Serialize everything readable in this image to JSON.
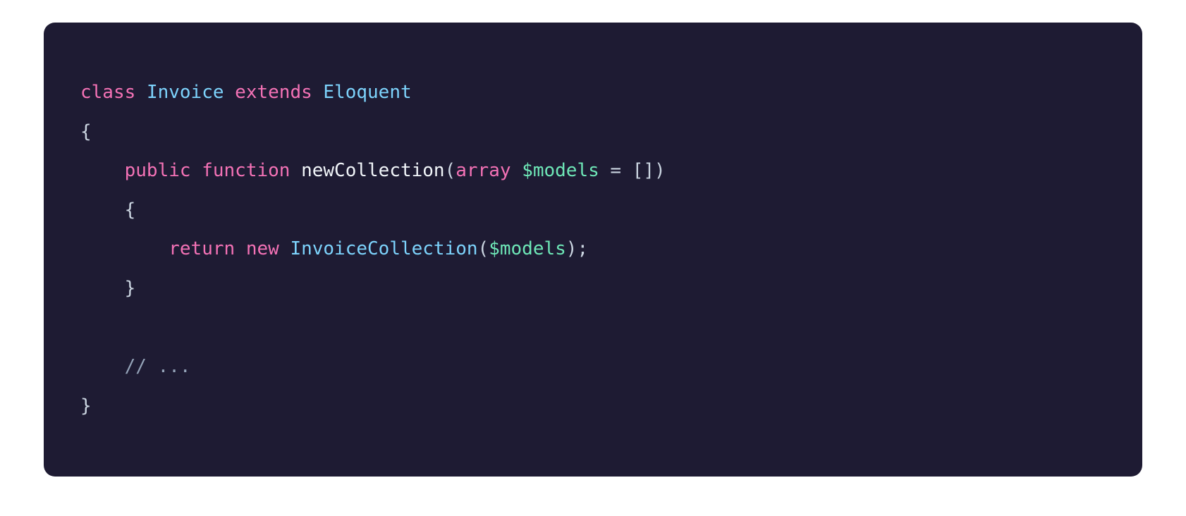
{
  "code": {
    "tokens": [
      [
        {
          "t": "class",
          "c": "tok-keyword"
        },
        {
          "t": " ",
          "c": ""
        },
        {
          "t": "Invoice",
          "c": "tok-class"
        },
        {
          "t": " ",
          "c": ""
        },
        {
          "t": "extends",
          "c": "tok-keyword"
        },
        {
          "t": " ",
          "c": ""
        },
        {
          "t": "Eloquent",
          "c": "tok-class"
        }
      ],
      [
        {
          "t": "{",
          "c": "tok-punct"
        }
      ],
      [
        {
          "t": "    ",
          "c": ""
        },
        {
          "t": "public",
          "c": "tok-keyword"
        },
        {
          "t": " ",
          "c": ""
        },
        {
          "t": "function",
          "c": "tok-keyword"
        },
        {
          "t": " ",
          "c": ""
        },
        {
          "t": "newCollection",
          "c": "tok-func"
        },
        {
          "t": "(",
          "c": "tok-punct"
        },
        {
          "t": "array",
          "c": "tok-type"
        },
        {
          "t": " ",
          "c": ""
        },
        {
          "t": "$models",
          "c": "tok-var"
        },
        {
          "t": " ",
          "c": ""
        },
        {
          "t": "=",
          "c": "tok-punct"
        },
        {
          "t": " ",
          "c": ""
        },
        {
          "t": "[]",
          "c": "tok-punct"
        },
        {
          "t": ")",
          "c": "tok-punct"
        }
      ],
      [
        {
          "t": "    ",
          "c": ""
        },
        {
          "t": "{",
          "c": "tok-punct"
        }
      ],
      [
        {
          "t": "        ",
          "c": ""
        },
        {
          "t": "return",
          "c": "tok-keyword"
        },
        {
          "t": " ",
          "c": ""
        },
        {
          "t": "new",
          "c": "tok-keyword"
        },
        {
          "t": " ",
          "c": ""
        },
        {
          "t": "InvoiceCollection",
          "c": "tok-class"
        },
        {
          "t": "(",
          "c": "tok-punct"
        },
        {
          "t": "$models",
          "c": "tok-var"
        },
        {
          "t": ")",
          "c": "tok-punct"
        },
        {
          "t": ";",
          "c": "tok-punct"
        }
      ],
      [
        {
          "t": "    ",
          "c": ""
        },
        {
          "t": "}",
          "c": "tok-punct"
        }
      ],
      [
        {
          "t": "",
          "c": ""
        }
      ],
      [
        {
          "t": "    ",
          "c": ""
        },
        {
          "t": "// ...",
          "c": "tok-comment"
        }
      ],
      [
        {
          "t": "}",
          "c": "tok-punct"
        }
      ]
    ]
  }
}
